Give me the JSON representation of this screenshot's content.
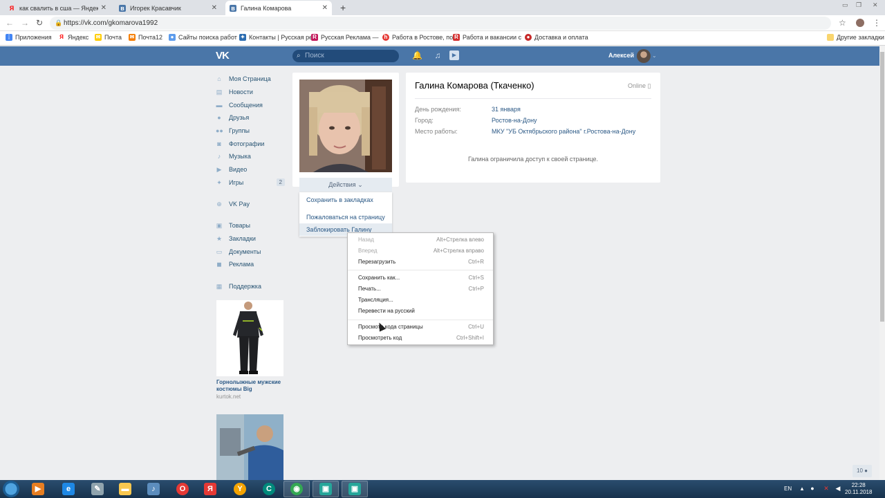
{
  "browser": {
    "tabs": [
      {
        "title": "как свалить в сша — Яндекс: нашлось",
        "icon": "yandex-icon",
        "color": "#ff0000"
      },
      {
        "title": "Игорек Красавчик",
        "icon": "vk-icon",
        "color": "#4a76a8"
      },
      {
        "title": "Галина Комарова",
        "icon": "vk-icon",
        "color": "#4a76a8"
      }
    ],
    "url": "https://vk.com/gkomarova1992",
    "bookmarks": [
      {
        "label": "Приложения",
        "color": "#4285f4"
      },
      {
        "label": "Яндекс",
        "color": "#ff0000"
      },
      {
        "label": "Почта",
        "color": "#ffcc00"
      },
      {
        "label": "Почта12",
        "color": "#f57c00"
      },
      {
        "label": "Сайты поиска работ",
        "color": "#5d9cec"
      },
      {
        "label": "Контакты | Русская ре",
        "color": "#2b6cb0"
      },
      {
        "label": "Русская Реклама —",
        "color": "#c2185b"
      },
      {
        "label": "Работа в Ростове, по",
        "color": "#e53935"
      },
      {
        "label": "Работа и вакансии с",
        "color": "#d32f2f"
      },
      {
        "label": "Доставка и оплата",
        "color": "#c62828"
      }
    ],
    "other_bookmarks": "Другие закладки"
  },
  "vk": {
    "search_placeholder": "Поиск",
    "user_name": "Алексей",
    "menu": [
      {
        "label": "Моя Страница",
        "icon": "home-icon"
      },
      {
        "label": "Новости",
        "icon": "news-icon"
      },
      {
        "label": "Сообщения",
        "icon": "messages-icon"
      },
      {
        "label": "Друзья",
        "icon": "friends-icon"
      },
      {
        "label": "Группы",
        "icon": "groups-icon"
      },
      {
        "label": "Фотографии",
        "icon": "photos-icon"
      },
      {
        "label": "Музыка",
        "icon": "music-icon"
      },
      {
        "label": "Видео",
        "icon": "video-icon"
      },
      {
        "label": "Игры",
        "icon": "games-icon",
        "count": "2"
      },
      {
        "label": "VK Pay",
        "icon": "vkpay-icon"
      },
      {
        "label": "Товары",
        "icon": "goods-icon"
      },
      {
        "label": "Закладки",
        "icon": "bookmarks-icon"
      },
      {
        "label": "Документы",
        "icon": "documents-icon"
      },
      {
        "label": "Реклама",
        "icon": "ads-icon"
      },
      {
        "label": "Поддержка",
        "icon": "support-icon"
      }
    ],
    "ads": [
      {
        "title": "Горнолыжные мужские костюмы Big",
        "source": "kurtok.net"
      },
      {
        "title": "",
        "source": ""
      }
    ],
    "profile": {
      "name": "Галина Комарова (Ткаченко)",
      "status": "Online",
      "actions_label": "Действия",
      "actions": [
        "Сохранить в закладках",
        "Пожаловаться на страницу",
        "Заблокировать Галину"
      ],
      "fields": [
        {
          "label": "День рождения:",
          "value": "31 января"
        },
        {
          "label": "Город:",
          "value": "Ростов-на-Дону"
        },
        {
          "label": "Место работы:",
          "value": "МКУ \"УБ Октябрьского района\" г.Ростова-на-Дону"
        }
      ],
      "restricted_text": "Галина ограничила доступ к своей странице."
    },
    "bottom_counter": "10"
  },
  "context_menu": [
    {
      "label": "Назад",
      "shortcut": "Alt+Стрелка влево",
      "disabled": true
    },
    {
      "label": "Вперед",
      "shortcut": "Alt+Стрелка вправо",
      "disabled": true
    },
    {
      "label": "Перезагрузить",
      "shortcut": "Ctrl+R",
      "disabled": false
    },
    {
      "label": "Сохранить как...",
      "shortcut": "Ctrl+S",
      "disabled": false
    },
    {
      "label": "Печать...",
      "shortcut": "Ctrl+P",
      "disabled": false
    },
    {
      "label": "Трансляция...",
      "shortcut": "",
      "disabled": false
    },
    {
      "label": "Перевести на русский",
      "shortcut": "",
      "disabled": false
    },
    {
      "label": "Просмотр кода страницы",
      "shortcut": "Ctrl+U",
      "disabled": false
    },
    {
      "label": "Просмотреть код",
      "shortcut": "Ctrl+Shift+I",
      "disabled": false
    }
  ],
  "taskbar": {
    "apps": [
      {
        "name": "media-player-icon",
        "color": "#e67e22",
        "glyph": "▶"
      },
      {
        "name": "internet-explorer-icon",
        "color": "#1e88e5",
        "glyph": "e"
      },
      {
        "name": "tools-icon",
        "color": "#90a4ae",
        "glyph": "✎"
      },
      {
        "name": "folder-icon",
        "color": "#f9c74f",
        "glyph": "▬"
      },
      {
        "name": "volume-app-icon",
        "color": "#5c8dbd",
        "glyph": "♪"
      },
      {
        "name": "opera-icon",
        "color": "#e53935",
        "glyph": "O"
      },
      {
        "name": "yandex-browser-icon",
        "color": "#e53935",
        "glyph": "Я"
      },
      {
        "name": "browser-y-icon",
        "color": "#f4a300",
        "glyph": "Y"
      },
      {
        "name": "ccleaner-icon",
        "color": "#00897b",
        "glyph": "C"
      },
      {
        "name": "chrome-icon",
        "color": "#34a853",
        "glyph": "◉"
      },
      {
        "name": "screen-recorder-icon",
        "color": "#26a69a",
        "glyph": "▣"
      },
      {
        "name": "screen-recorder-2-icon",
        "color": "#26a69a",
        "glyph": "▣"
      }
    ],
    "lang": "EN",
    "time": "22:28",
    "date": "20.11.2018"
  }
}
